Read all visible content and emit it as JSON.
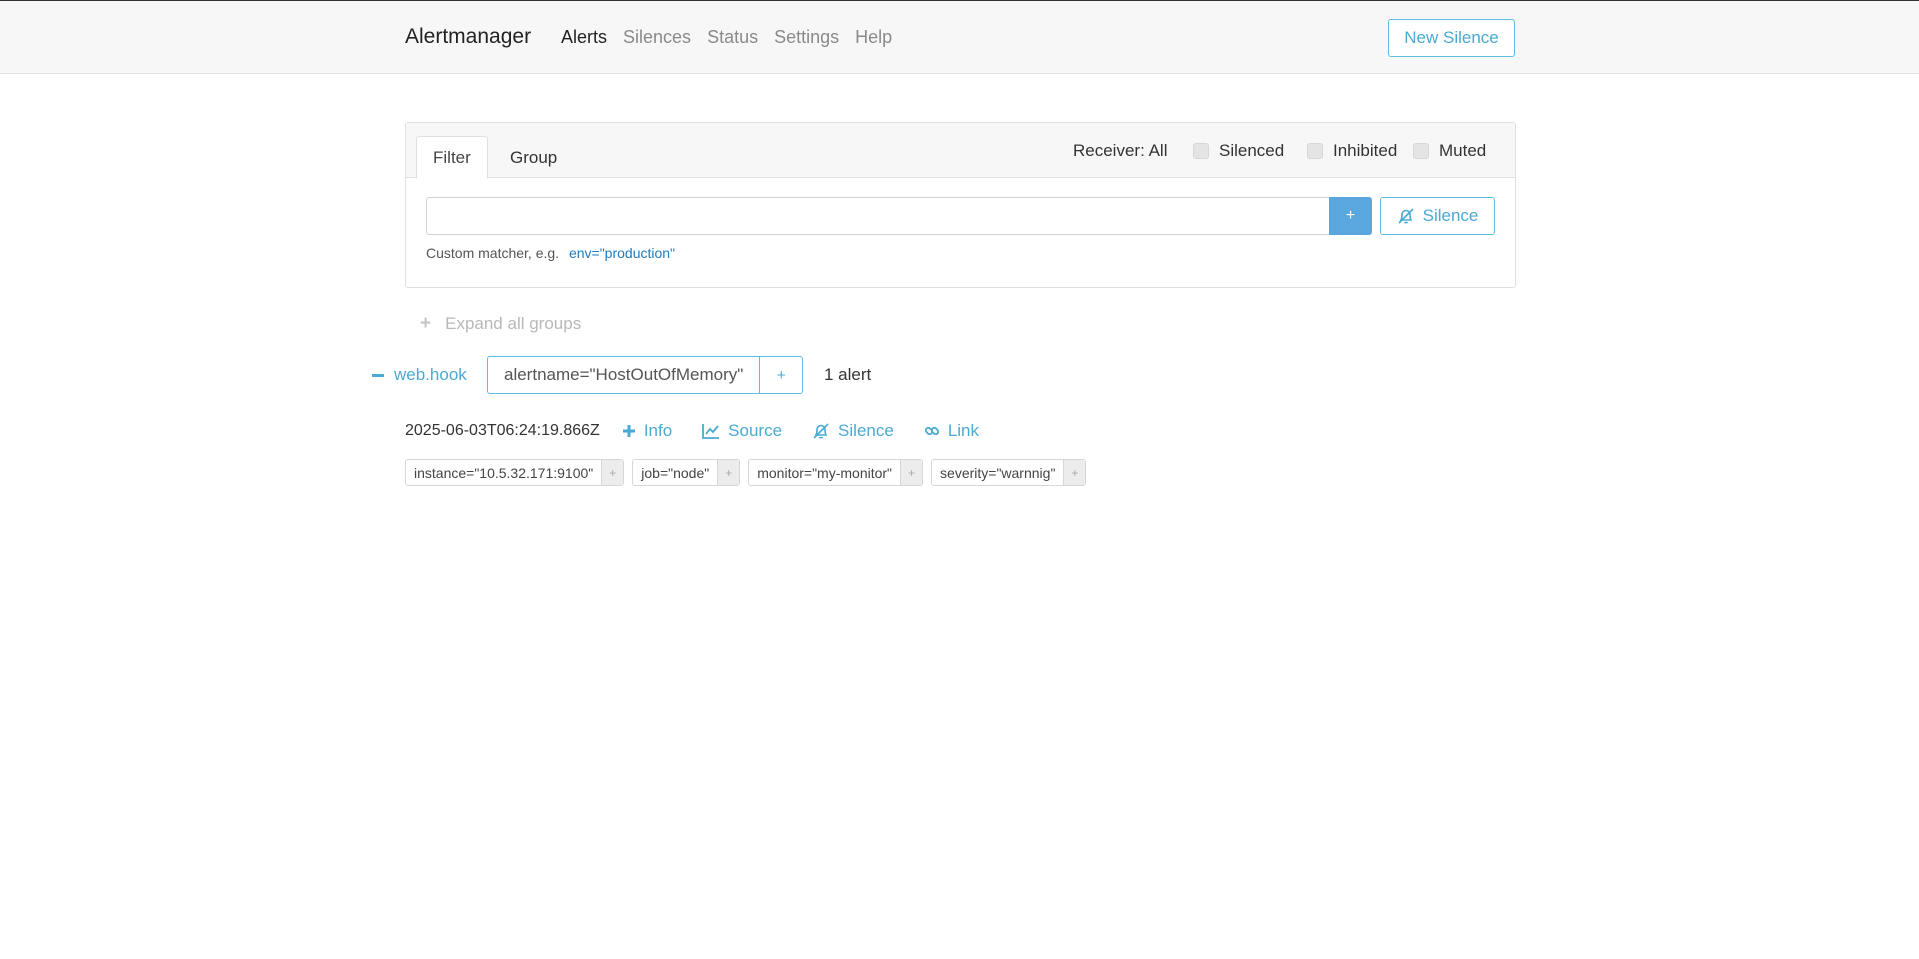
{
  "nav": {
    "brand": "Alertmanager",
    "links": [
      {
        "label": "Alerts",
        "active": true
      },
      {
        "label": "Silences",
        "active": false
      },
      {
        "label": "Status",
        "active": false
      },
      {
        "label": "Settings",
        "active": false
      },
      {
        "label": "Help",
        "active": false
      }
    ],
    "new_silence": "New Silence"
  },
  "filter": {
    "tabs": [
      "Filter",
      "Group"
    ],
    "receiver": "Receiver: All",
    "checkboxes": [
      "Silenced",
      "Inhibited",
      "Muted"
    ],
    "input_value": "",
    "add_label": "+",
    "silence_label": "Silence",
    "hint": "Custom matcher, e.g.",
    "hint_example": "env=\"production\""
  },
  "expand_all": "Expand all groups",
  "group": {
    "receiver": "web.hook",
    "matcher": "alertname=\"HostOutOfMemory\"",
    "plus": "+",
    "count": "1 alert"
  },
  "alert": {
    "timestamp": "2025-06-03T06:24:19.866Z",
    "actions": [
      "Info",
      "Source",
      "Silence",
      "Link"
    ],
    "labels": [
      "instance=\"10.5.32.171:9100\"",
      "job=\"node\"",
      "monitor=\"my-monitor\"",
      "severity=\"warnnig\""
    ],
    "label_plus": "+"
  },
  "colors": {
    "accent": "#4aaad2",
    "primary_button": "#5aa7e0",
    "link": "#1d7bbf"
  }
}
